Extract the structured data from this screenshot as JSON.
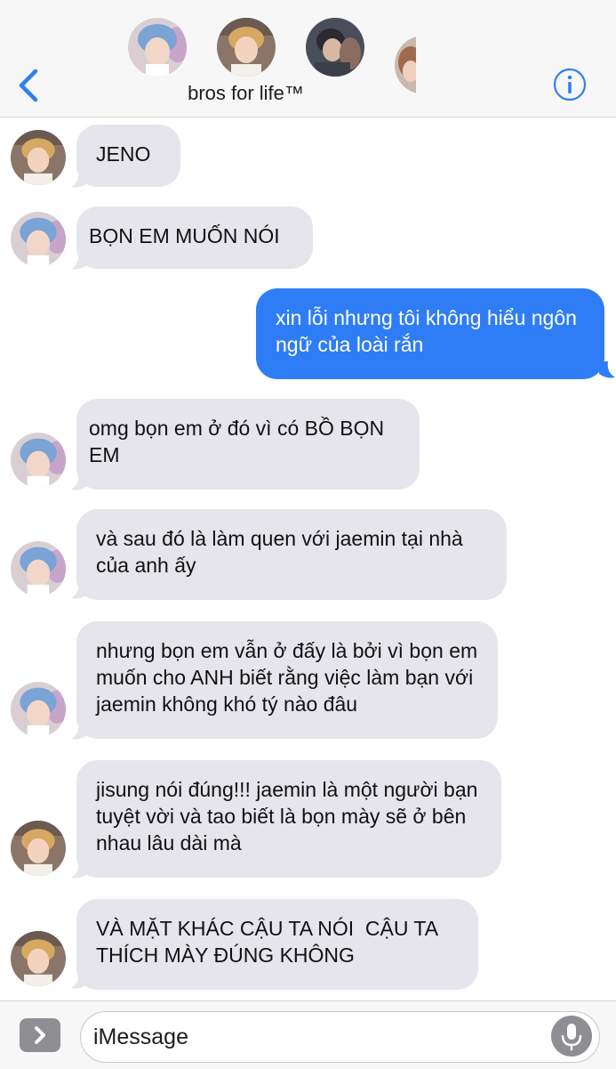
{
  "header": {
    "group_name": "bros for life™",
    "back_icon": "chevron-left-icon",
    "info_icon": "info-icon",
    "accent_color": "#2f7df6"
  },
  "messages": [
    {
      "sender": "jaemin",
      "text": "JENO",
      "from_me": false
    },
    {
      "sender": "jisung",
      "text": "BỌN EM MUỐN NÓI",
      "from_me": false
    },
    {
      "sender": "me",
      "text": "xin lỗi nhưng tôi không hiểu ngôn ngữ của loài rắn",
      "from_me": true
    },
    {
      "sender": "jisung",
      "text": "omg bọn em ở đó vì có BỒ BỌN EM",
      "from_me": false
    },
    {
      "sender": "jisung",
      "text": "và sau đó là làm quen với jaemin tại nhà của anh ấy",
      "from_me": false
    },
    {
      "sender": "jisung",
      "text": "nhưng bọn em vẫn ở đấy là bởi vì bọn em muốn cho ANH biết rằng việc làm bạn với jaemin không khó tý nào đâu",
      "from_me": false
    },
    {
      "sender": "jaemin",
      "text": "jisung nói đúng!!! jaemin là một người bạn tuyệt vời và tao biết là bọn mày sẽ ở bên nhau lâu dài mà",
      "from_me": false
    },
    {
      "sender": "jaemin",
      "text": "VÀ MẶT KHÁC CẬU TA NÓI  CẬU TA THÍCH MÀY ĐÚNG KHÔNG",
      "from_me": false
    }
  ],
  "input": {
    "placeholder": "iMessage",
    "apps_icon": "chevron-right-icon",
    "mic_icon": "microphone-icon"
  }
}
